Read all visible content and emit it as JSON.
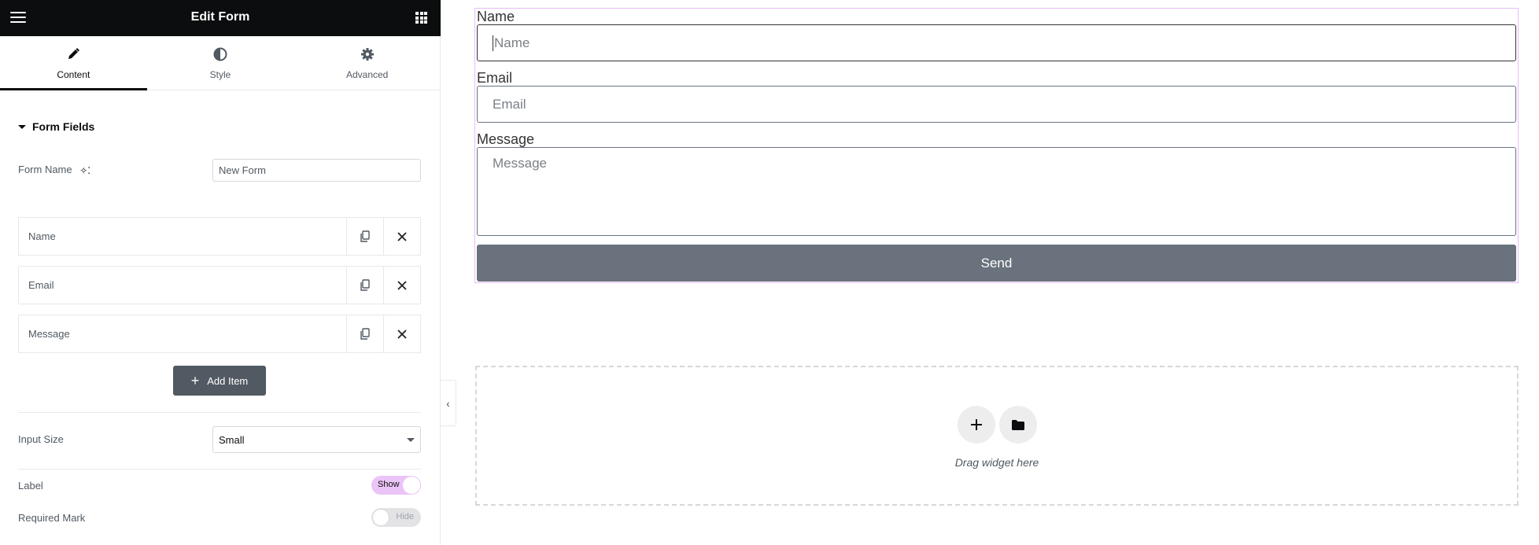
{
  "panel": {
    "title": "Edit Form",
    "tabs": [
      {
        "label": "Content",
        "icon": "pencil-icon",
        "active": true
      },
      {
        "label": "Style",
        "icon": "half-circle-icon",
        "active": false
      },
      {
        "label": "Advanced",
        "icon": "gear-icon",
        "active": false
      }
    ],
    "section_title": "Form Fields",
    "form_name": {
      "label": "Form Name",
      "value": "New Form"
    },
    "fields": [
      {
        "label": "Name"
      },
      {
        "label": "Email"
      },
      {
        "label": "Message"
      }
    ],
    "add_item_label": "Add Item",
    "input_size": {
      "label": "Input Size",
      "value": "Small"
    },
    "label_toggle": {
      "label": "Label",
      "state": "Show",
      "on": true
    },
    "required_toggle": {
      "label": "Required Mark",
      "state": "Hide",
      "on": false
    }
  },
  "form": {
    "fields": [
      {
        "label": "Name",
        "placeholder": "Name"
      },
      {
        "label": "Email",
        "placeholder": "Email"
      },
      {
        "label": "Message",
        "placeholder": "Message"
      }
    ],
    "submit_label": "Send"
  },
  "drop_zone": {
    "text": "Drag widget here"
  },
  "colors": {
    "accent": "#e8bdf6",
    "button": "#69727d",
    "header": "#0c0d0e"
  }
}
